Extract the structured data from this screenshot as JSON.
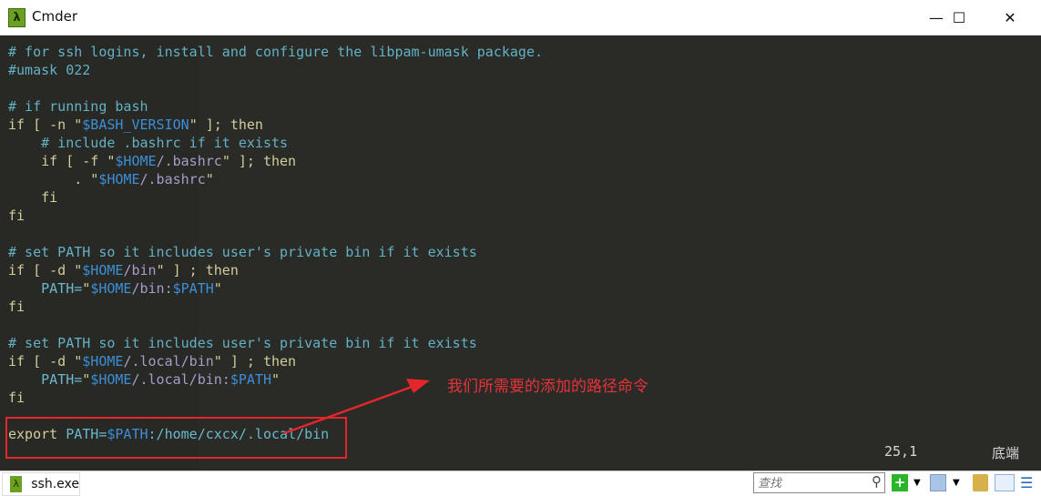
{
  "window": {
    "title": "Cmder",
    "app_icon": "lambda-icon",
    "minimize": "—",
    "maximize": "☐",
    "close": "✕"
  },
  "code_lines": [
    [
      [
        "c",
        "# for ssh logins, install and configure the libpam-umask package."
      ]
    ],
    [
      [
        "c",
        "#umask 022"
      ]
    ],
    [],
    [
      [
        "c",
        "# if running bash"
      ]
    ],
    [
      [
        "k",
        "if [ -n \""
      ],
      [
        "v",
        "$BASH_VERSION"
      ],
      [
        "k",
        "\" ]; then"
      ]
    ],
    [
      [
        "c",
        "    # include .bashrc if it exists"
      ]
    ],
    [
      [
        "k",
        "    if [ -f \""
      ],
      [
        "v",
        "$HOME"
      ],
      [
        "s",
        "/.bashrc"
      ],
      [
        "k",
        "\" ]; then"
      ]
    ],
    [
      [
        "k",
        "        . \""
      ],
      [
        "v",
        "$HOME"
      ],
      [
        "s",
        "/.bashrc"
      ],
      [
        "k",
        "\""
      ]
    ],
    [
      [
        "k",
        "    fi"
      ]
    ],
    [
      [
        "k",
        "fi"
      ]
    ],
    [],
    [
      [
        "c",
        "# set PATH so it includes user's private bin if it exists"
      ]
    ],
    [
      [
        "k",
        "if [ -d \""
      ],
      [
        "v",
        "$HOME"
      ],
      [
        "s",
        "/bin"
      ],
      [
        "k",
        "\" ] ; then"
      ]
    ],
    [
      [
        "p",
        "    PATH="
      ],
      [
        "k",
        "\""
      ],
      [
        "v",
        "$HOME"
      ],
      [
        "s",
        "/bin:"
      ],
      [
        "v",
        "$PATH"
      ],
      [
        "k",
        "\""
      ]
    ],
    [
      [
        "k",
        "fi"
      ]
    ],
    [],
    [
      [
        "c",
        "# set PATH so it includes user's private bin if it exists"
      ]
    ],
    [
      [
        "k",
        "if [ -d \""
      ],
      [
        "v",
        "$HOME"
      ],
      [
        "s",
        "/.local/bin"
      ],
      [
        "k",
        "\" ] ; then"
      ]
    ],
    [
      [
        "p",
        "    PATH="
      ],
      [
        "k",
        "\""
      ],
      [
        "v",
        "$HOME"
      ],
      [
        "s",
        "/.local/bin:"
      ],
      [
        "v",
        "$PATH"
      ],
      [
        "k",
        "\""
      ]
    ],
    [
      [
        "k",
        "fi"
      ]
    ],
    [],
    [
      [
        "k",
        "export "
      ],
      [
        "p",
        "PATH="
      ],
      [
        "v",
        "$PATH"
      ],
      [
        "p",
        ":/home/cxcx/.local/bin"
      ]
    ]
  ],
  "status": {
    "position": "25,1",
    "scroll": "底端"
  },
  "annotation": {
    "text": "我们所需要的添加的路径命令",
    "color": "#e3262c"
  },
  "taskbar": {
    "tab_label": "ssh.exe",
    "search_placeholder": "查找",
    "icons": [
      "search-icon",
      "new-console-icon",
      "dropdown-icon",
      "tab-switch-icon",
      "dropdown-icon",
      "lock-icon",
      "split-view-icon",
      "menu-icon"
    ]
  },
  "colors": {
    "background": "#282824",
    "comment": "#63b1c6",
    "keyword": "#d2cd9c",
    "variable": "#3c8fd8",
    "string": "#a99ccb"
  }
}
